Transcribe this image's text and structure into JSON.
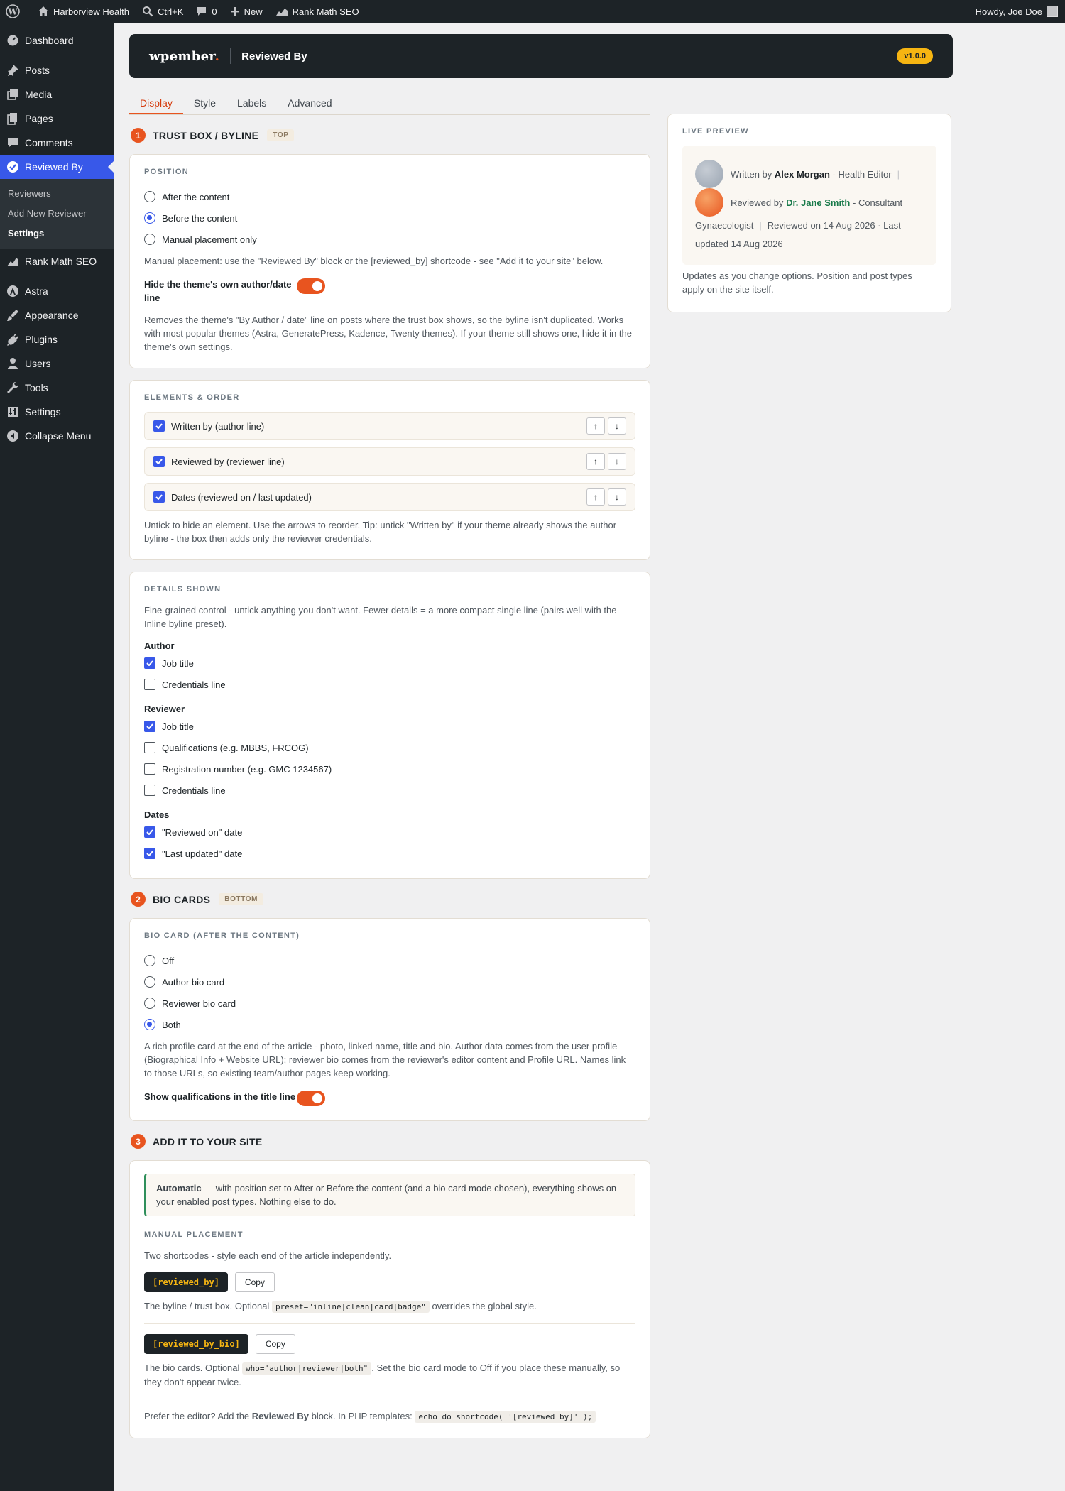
{
  "adminbar": {
    "site": "Harborview Health",
    "search": "Ctrl+K",
    "comments": "0",
    "new": "New",
    "rankmath": "Rank Math SEO",
    "howdy": "Howdy, Joe Doe"
  },
  "sidebar": {
    "items": [
      {
        "label": "Dashboard"
      },
      {
        "label": "Posts"
      },
      {
        "label": "Media"
      },
      {
        "label": "Pages"
      },
      {
        "label": "Comments"
      },
      {
        "label": "Reviewed By"
      },
      {
        "label": "Rank Math SEO"
      },
      {
        "label": "Astra"
      },
      {
        "label": "Appearance"
      },
      {
        "label": "Plugins"
      },
      {
        "label": "Users"
      },
      {
        "label": "Tools"
      },
      {
        "label": "Settings"
      },
      {
        "label": "Collapse Menu"
      }
    ],
    "submenu": [
      "Reviewers",
      "Add New Reviewer",
      "Settings"
    ]
  },
  "header": {
    "brand": "wpember",
    "brand_dot": ".",
    "title": "Reviewed By",
    "version": "v1.0.0"
  },
  "tabs": [
    "Display",
    "Style",
    "Labels",
    "Advanced"
  ],
  "section1": {
    "num": "1",
    "title": "TRUST BOX / BYLINE",
    "tag": "TOP",
    "position": {
      "label": "POSITION",
      "options": [
        "After the content",
        "Before the content",
        "Manual placement only"
      ],
      "help": "Manual placement: use the \"Reviewed By\" block or the [reviewed_by] shortcode - see \"Add it to your site\" below.",
      "toggle_label": "Hide the theme's own author/date line",
      "toggle_help": "Removes the theme's \"By Author / date\" line on posts where the trust box shows, so the byline isn't duplicated. Works with most popular themes (Astra, GeneratePress, Kadence, Twenty themes). If your theme still shows one, hide it in the theme's own settings."
    },
    "elements": {
      "label": "ELEMENTS & ORDER",
      "rows": [
        "Written by (author line)",
        "Reviewed by (reviewer line)",
        "Dates (reviewed on / last updated)"
      ],
      "up": "↑",
      "down": "↓",
      "help": "Untick to hide an element. Use the arrows to reorder. Tip: untick \"Written by\" if your theme already shows the author byline - the box then adds only the reviewer credentials."
    },
    "details": {
      "label": "DETAILS SHOWN",
      "help": "Fine-grained control - untick anything you don't want. Fewer details = a more compact single line (pairs well with the Inline byline preset).",
      "author_label": "Author",
      "author": [
        "Job title",
        "Credentials line"
      ],
      "reviewer_label": "Reviewer",
      "reviewer": [
        "Job title",
        "Qualifications (e.g. MBBS, FRCOG)",
        "Registration number (e.g. GMC 1234567)",
        "Credentials line"
      ],
      "dates_label": "Dates",
      "dates": [
        "\"Reviewed on\" date",
        "\"Last updated\" date"
      ]
    }
  },
  "section2": {
    "num": "2",
    "title": "BIO CARDS",
    "tag": "BOTTOM",
    "label": "BIO CARD (AFTER THE CONTENT)",
    "options": [
      "Off",
      "Author bio card",
      "Reviewer bio card",
      "Both"
    ],
    "help": "A rich profile card at the end of the article - photo, linked name, title and bio. Author data comes from the user profile (Biographical Info + Website URL); reviewer bio comes from the reviewer's editor content and Profile URL. Names link to those URLs, so existing team/author pages keep working.",
    "toggle_label": "Show qualifications in the title line"
  },
  "section3": {
    "num": "3",
    "title": "ADD IT TO YOUR SITE",
    "notice_strong": "Automatic",
    "notice_rest": " — with position set to After or Before the content (and a bio card mode chosen), everything shows on your enabled post types. Nothing else to do.",
    "manual_label": "MANUAL PLACEMENT",
    "manual_help": "Two shortcodes - style each end of the article independently.",
    "code1": "[reviewed_by]",
    "copy": "Copy",
    "code1_help_a": "The byline / trust box. Optional ",
    "code1_inline": "preset=\"inline|clean|card|badge\"",
    "code1_help_b": " overrides the global style.",
    "code2": "[reviewed_by_bio]",
    "code2_help_a": "The bio cards. Optional ",
    "code2_inline": "who=\"author|reviewer|both\"",
    "code2_help_b": ". Set the bio card mode to Off if you place these manually, so they don't appear twice.",
    "footer_a": "Prefer the editor? Add the ",
    "footer_strong": "Reviewed By",
    "footer_b": " block. In PHP templates: ",
    "footer_code": "echo do_shortcode( '[reviewed_by]' );"
  },
  "preview": {
    "label": "LIVE PREVIEW",
    "written_by": "Written by",
    "author_name": "Alex Morgan",
    "author_title": "- Health Editor",
    "reviewed_by": "Reviewed by",
    "reviewer_name": "Dr. Jane Smith",
    "reviewer_title": "- Consultant",
    "reviewer_title2": "Gynaecologist",
    "dates": "Reviewed on 14 Aug 2026 · Last updated 14 Aug 2026",
    "sep": "|",
    "foot": "Updates as you change options. Position and post types apply on the site itself."
  },
  "colors": {
    "accent": "#e8541f",
    "admin_blue": "#3858e9",
    "dark": "#1d2327",
    "version_badge": "#f6b512",
    "link_green": "#187a4a"
  }
}
